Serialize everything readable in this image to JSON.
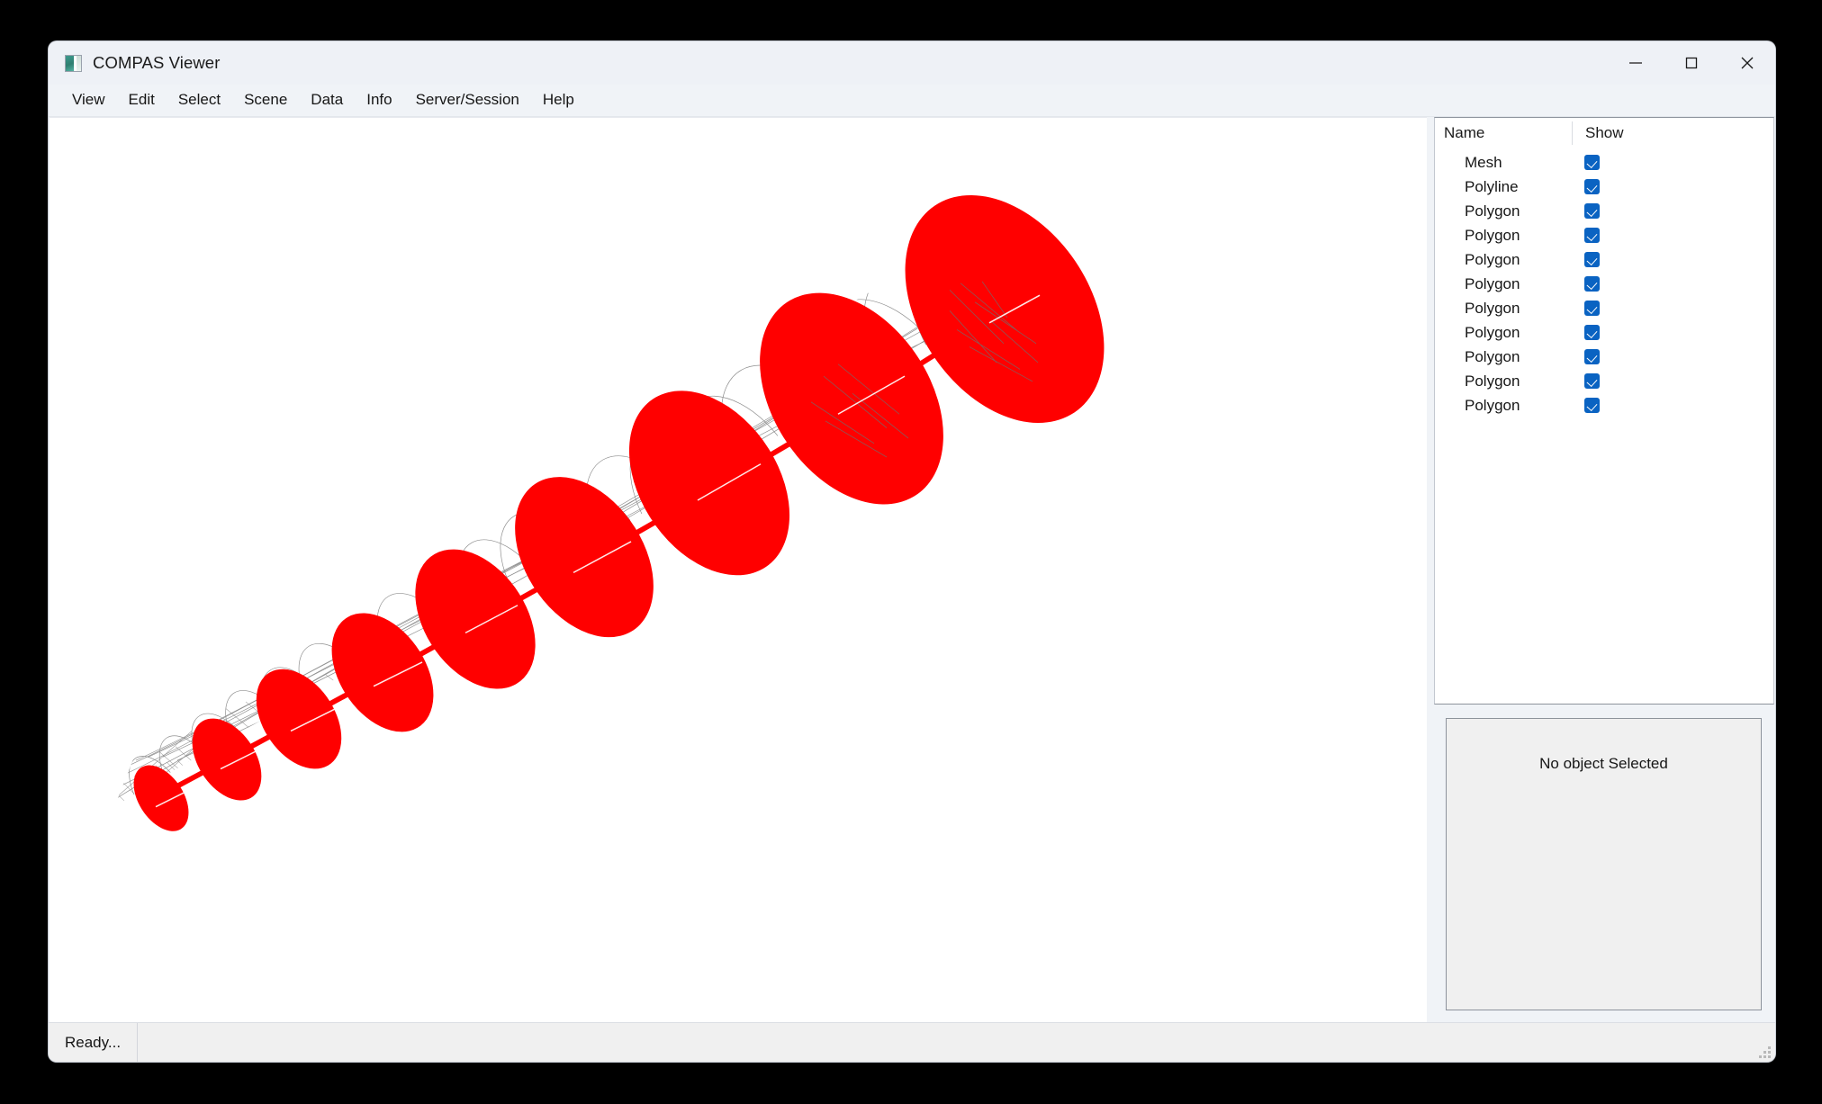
{
  "window": {
    "title": "COMPAS Viewer",
    "app_icon": "app-logo-icon",
    "controls": {
      "minimize": "minimize-icon",
      "maximize": "maximize-icon",
      "close": "close-icon"
    }
  },
  "menubar": {
    "items": [
      {
        "label": "View"
      },
      {
        "label": "Edit"
      },
      {
        "label": "Select"
      },
      {
        "label": "Scene"
      },
      {
        "label": "Data"
      },
      {
        "label": "Info"
      },
      {
        "label": "Server/Session"
      },
      {
        "label": "Help"
      }
    ]
  },
  "scene_tree": {
    "columns": {
      "name": "Name",
      "show": "Show"
    },
    "rows": [
      {
        "name": "Mesh",
        "show": true
      },
      {
        "name": "Polyline",
        "show": true
      },
      {
        "name": "Polygon",
        "show": true
      },
      {
        "name": "Polygon",
        "show": true
      },
      {
        "name": "Polygon",
        "show": true
      },
      {
        "name": "Polygon",
        "show": true
      },
      {
        "name": "Polygon",
        "show": true
      },
      {
        "name": "Polygon",
        "show": true
      },
      {
        "name": "Polygon",
        "show": true
      },
      {
        "name": "Polygon",
        "show": true
      },
      {
        "name": "Polygon",
        "show": true
      }
    ]
  },
  "info_panel": {
    "message": "No object Selected"
  },
  "statusbar": {
    "message": "Ready..."
  },
  "viewport": {
    "background": "#ffffff",
    "mesh_color": "#808080",
    "polygon_color": "#ff0000",
    "polyline_color": "#ff0000",
    "description": "Triangulated tapered tube mesh wireframe with nine red elliptical cross-section polygons and a red polyline axis"
  }
}
